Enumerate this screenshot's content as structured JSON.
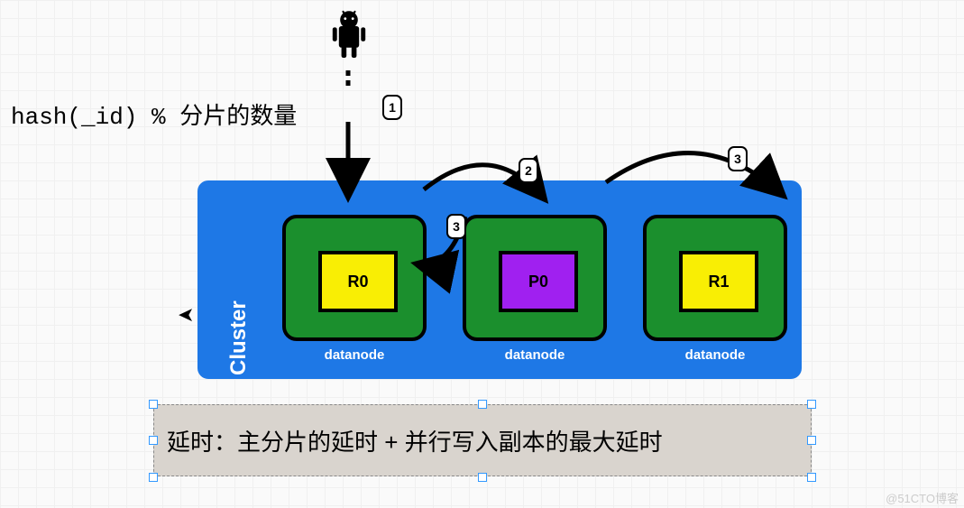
{
  "formula": {
    "code": "hash(_id) %",
    "suffix": "分片的数量"
  },
  "cluster": {
    "label": "Cluster",
    "nodes": [
      {
        "shard": "R0",
        "color": "yellow",
        "label": "datanode"
      },
      {
        "shard": "P0",
        "color": "purple",
        "label": "datanode"
      },
      {
        "shard": "R1",
        "color": "yellow",
        "label": "datanode"
      }
    ]
  },
  "arrows": [
    {
      "badge": "1",
      "from": "android",
      "to": "R0"
    },
    {
      "badge": "2",
      "from": "R0-edge",
      "to": "P0"
    },
    {
      "badge": "3",
      "from": "P0-edge",
      "to": "R1"
    },
    {
      "badge": "3",
      "from": "P0-corner",
      "to": "R0-return"
    }
  ],
  "caption": "延时：主分片的延时 + 并行写入副本的最大延时",
  "icons": {
    "top": "android",
    "cursor": "pointer"
  },
  "watermark": "@51CTO博客"
}
